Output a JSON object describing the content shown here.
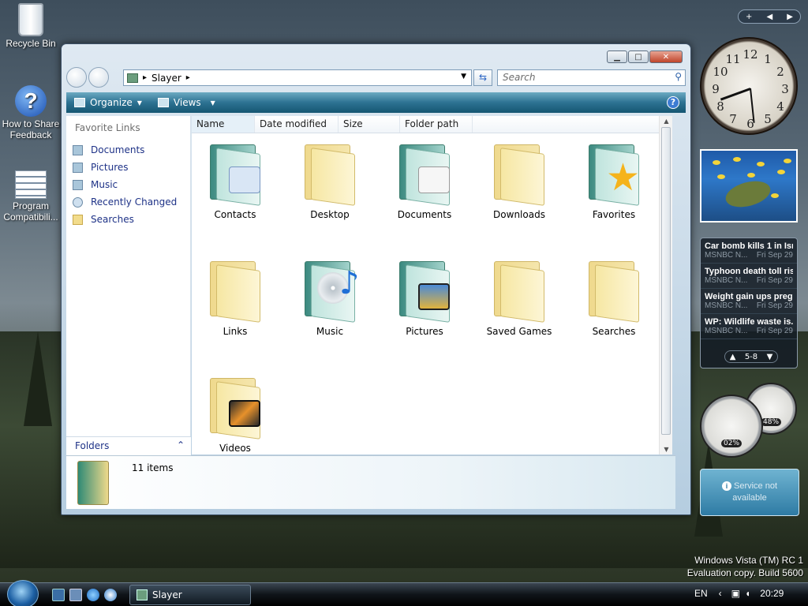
{
  "desktop": {
    "icons": [
      {
        "label": "Recycle Bin"
      },
      {
        "label": "How to Share Feedback"
      },
      {
        "label": "Program Compatibili..."
      }
    ],
    "watermark_line1": "Windows Vista (TM) RC 1",
    "watermark_line2": "Evaluation copy. Build 5600"
  },
  "window": {
    "controls": {
      "minimize": "▁",
      "maximize": "□",
      "close": "✕"
    },
    "address": {
      "segment": "Slayer",
      "arrow": "▸"
    },
    "search": {
      "placeholder": "Search"
    },
    "toolbar": {
      "organize": "Organize",
      "views": "Views",
      "help": "?"
    },
    "favorite_links": {
      "header": "Favorite Links",
      "items": [
        {
          "label": "Documents"
        },
        {
          "label": "Pictures"
        },
        {
          "label": "Music"
        },
        {
          "label": "Recently Changed"
        },
        {
          "label": "Searches"
        }
      ]
    },
    "folders_label": "Folders",
    "columns": [
      "Name",
      "Date modified",
      "Size",
      "Folder path"
    ],
    "items": [
      {
        "label": "Contacts"
      },
      {
        "label": "Desktop"
      },
      {
        "label": "Documents"
      },
      {
        "label": "Downloads"
      },
      {
        "label": "Favorites"
      },
      {
        "label": "Links"
      },
      {
        "label": "Music"
      },
      {
        "label": "Pictures"
      },
      {
        "label": "Saved Games"
      },
      {
        "label": "Searches"
      },
      {
        "label": "Videos"
      }
    ],
    "status": "11 items"
  },
  "sidebar": {
    "controls": {
      "add": "+",
      "prev": "◀",
      "next": "▶"
    },
    "clock": {
      "numbers": [
        "12",
        "1",
        "2",
        "3",
        "4",
        "5",
        "6",
        "7",
        "8",
        "9",
        "10",
        "11"
      ]
    },
    "news": [
      {
        "title": "Car bomb kills 1 in Isr...",
        "source": "MSNBC N...",
        "date": "Fri Sep 29"
      },
      {
        "title": "Typhoon death toll ris...",
        "source": "MSNBC N...",
        "date": "Fri Sep 29"
      },
      {
        "title": "Weight gain ups preg...",
        "source": "MSNBC N...",
        "date": "Fri Sep 29"
      },
      {
        "title": "WP: Wildlife waste is...",
        "source": "MSNBC N...",
        "date": "Fri Sep 29"
      }
    ],
    "news_pager": "5-8",
    "cpu_value": "02%",
    "mem_value": "48%",
    "service_line1": "Service not",
    "service_line2": "available"
  },
  "taskbar": {
    "task_label": "Slayer",
    "lang": "EN",
    "time": "20:29"
  }
}
